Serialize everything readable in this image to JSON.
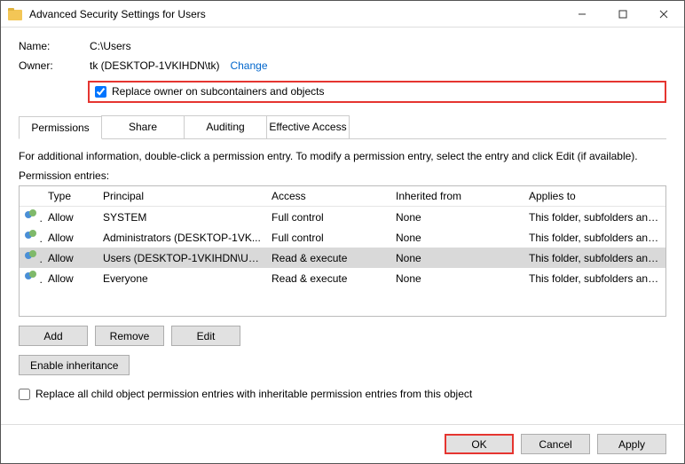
{
  "window": {
    "title": "Advanced Security Settings for Users"
  },
  "labels": {
    "name": "Name:",
    "owner": "Owner:",
    "change": "Change",
    "replace_owner": "Replace owner on subcontainers and objects",
    "info": "For additional information, double-click a permission entry. To modify a permission entry, select the entry and click Edit (if available).",
    "entries": "Permission entries:",
    "replace_children": "Replace all child object permission entries with inheritable permission entries from this object"
  },
  "values": {
    "name": "C:\\Users",
    "owner": "tk (DESKTOP-1VKIHDN\\tk)"
  },
  "tabs": [
    {
      "label": "Permissions",
      "active": true
    },
    {
      "label": "Share",
      "active": false
    },
    {
      "label": "Auditing",
      "active": false
    },
    {
      "label": "Effective Access",
      "active": false
    }
  ],
  "columns": {
    "type": "Type",
    "principal": "Principal",
    "access": "Access",
    "inherited": "Inherited from",
    "applies": "Applies to"
  },
  "rows": [
    {
      "type": "Allow",
      "principal": "SYSTEM",
      "access": "Full control",
      "inherited": "None",
      "applies": "This folder, subfolders and files",
      "selected": false
    },
    {
      "type": "Allow",
      "principal": "Administrators (DESKTOP-1VK...",
      "access": "Full control",
      "inherited": "None",
      "applies": "This folder, subfolders and files",
      "selected": false
    },
    {
      "type": "Allow",
      "principal": "Users (DESKTOP-1VKIHDN\\Us...",
      "access": "Read & execute",
      "inherited": "None",
      "applies": "This folder, subfolders and files",
      "selected": true
    },
    {
      "type": "Allow",
      "principal": "Everyone",
      "access": "Read & execute",
      "inherited": "None",
      "applies": "This folder, subfolders and files",
      "selected": false
    }
  ],
  "buttons": {
    "add": "Add",
    "remove": "Remove",
    "edit": "Edit",
    "enable_inh": "Enable inheritance",
    "ok": "OK",
    "cancel": "Cancel",
    "apply": "Apply"
  }
}
